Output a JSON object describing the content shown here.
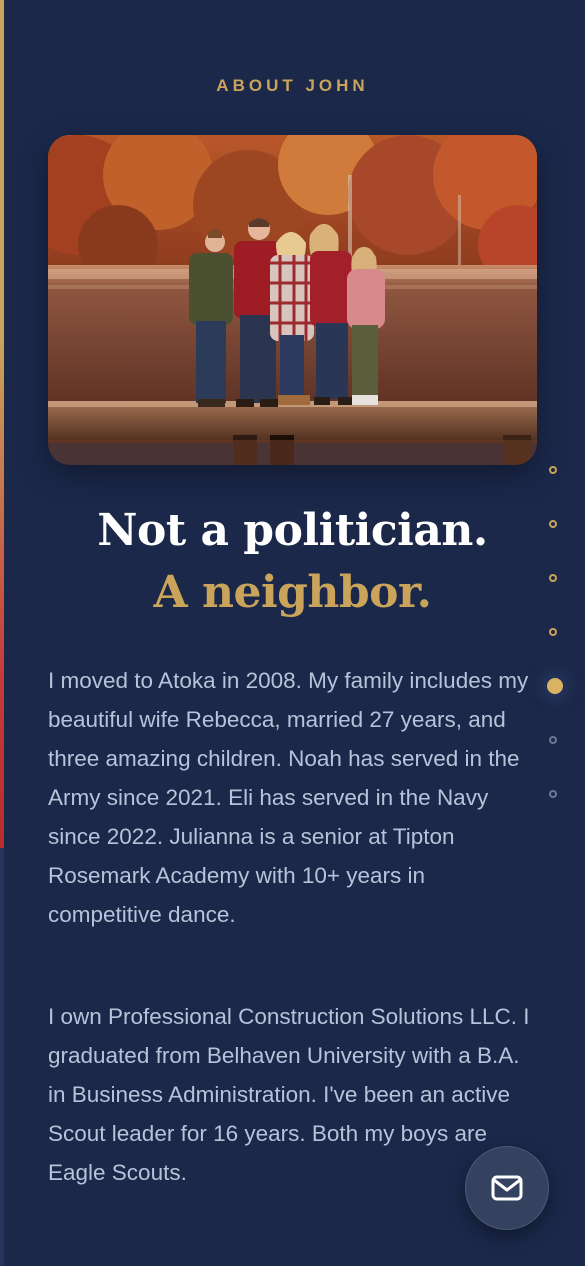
{
  "section": {
    "eyebrow": "ABOUT JOHN"
  },
  "photo": {
    "description_icon": "family-photo"
  },
  "headline": {
    "line1": "Not a politician.",
    "line2": "A neighbor."
  },
  "body": {
    "paragraph1": "I moved to Atoka in 2008. My family includes my beautiful wife Rebecca, married 27 years, and three amazing children. Noah has served in the Army since 2021. Eli has served in the Navy since 2022. Julianna is a senior at Tipton Rosemark Academy with 10+ years in competitive dance.",
    "paragraph2": "I own Professional Construction Solutions LLC. I graduated from Belhaven University with a B.A. in Business Administration. I've been an active Scout leader for 16 years. Both my boys are Eagle Scouts."
  },
  "section_nav": {
    "total": 7,
    "active_index": 4
  },
  "scroll_progress": 0.67,
  "contact_button": {
    "icon": "mail-icon"
  },
  "colors": {
    "background": "#1b284a",
    "accent_gold": "#c9a45a",
    "accent_red": "#c63a3a",
    "body_text": "#b8c2d8",
    "heading_text": "#ffffff"
  }
}
